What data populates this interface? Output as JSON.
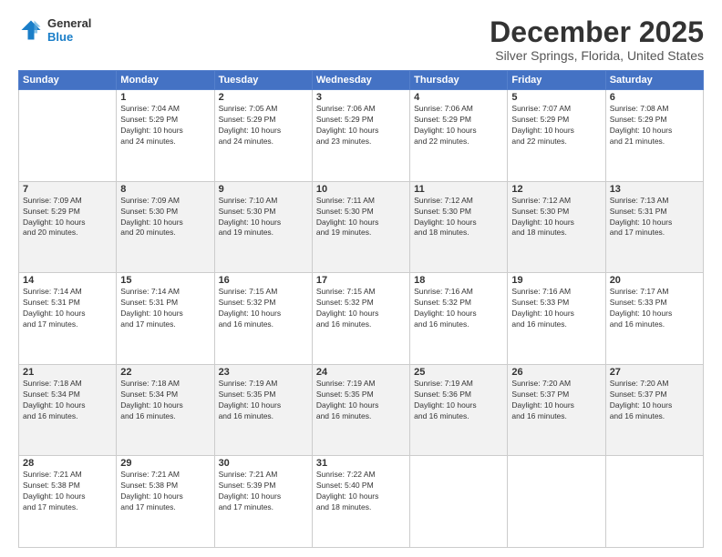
{
  "header": {
    "logo_line1": "General",
    "logo_line2": "Blue",
    "title": "December 2025",
    "subtitle": "Silver Springs, Florida, United States"
  },
  "calendar": {
    "days_of_week": [
      "Sunday",
      "Monday",
      "Tuesday",
      "Wednesday",
      "Thursday",
      "Friday",
      "Saturday"
    ],
    "rows": [
      [
        {
          "day": "",
          "info": ""
        },
        {
          "day": "1",
          "info": "Sunrise: 7:04 AM\nSunset: 5:29 PM\nDaylight: 10 hours\nand 24 minutes."
        },
        {
          "day": "2",
          "info": "Sunrise: 7:05 AM\nSunset: 5:29 PM\nDaylight: 10 hours\nand 24 minutes."
        },
        {
          "day": "3",
          "info": "Sunrise: 7:06 AM\nSunset: 5:29 PM\nDaylight: 10 hours\nand 23 minutes."
        },
        {
          "day": "4",
          "info": "Sunrise: 7:06 AM\nSunset: 5:29 PM\nDaylight: 10 hours\nand 22 minutes."
        },
        {
          "day": "5",
          "info": "Sunrise: 7:07 AM\nSunset: 5:29 PM\nDaylight: 10 hours\nand 22 minutes."
        },
        {
          "day": "6",
          "info": "Sunrise: 7:08 AM\nSunset: 5:29 PM\nDaylight: 10 hours\nand 21 minutes."
        }
      ],
      [
        {
          "day": "7",
          "info": "Sunrise: 7:09 AM\nSunset: 5:29 PM\nDaylight: 10 hours\nand 20 minutes."
        },
        {
          "day": "8",
          "info": "Sunrise: 7:09 AM\nSunset: 5:30 PM\nDaylight: 10 hours\nand 20 minutes."
        },
        {
          "day": "9",
          "info": "Sunrise: 7:10 AM\nSunset: 5:30 PM\nDaylight: 10 hours\nand 19 minutes."
        },
        {
          "day": "10",
          "info": "Sunrise: 7:11 AM\nSunset: 5:30 PM\nDaylight: 10 hours\nand 19 minutes."
        },
        {
          "day": "11",
          "info": "Sunrise: 7:12 AM\nSunset: 5:30 PM\nDaylight: 10 hours\nand 18 minutes."
        },
        {
          "day": "12",
          "info": "Sunrise: 7:12 AM\nSunset: 5:30 PM\nDaylight: 10 hours\nand 18 minutes."
        },
        {
          "day": "13",
          "info": "Sunrise: 7:13 AM\nSunset: 5:31 PM\nDaylight: 10 hours\nand 17 minutes."
        }
      ],
      [
        {
          "day": "14",
          "info": "Sunrise: 7:14 AM\nSunset: 5:31 PM\nDaylight: 10 hours\nand 17 minutes."
        },
        {
          "day": "15",
          "info": "Sunrise: 7:14 AM\nSunset: 5:31 PM\nDaylight: 10 hours\nand 17 minutes."
        },
        {
          "day": "16",
          "info": "Sunrise: 7:15 AM\nSunset: 5:32 PM\nDaylight: 10 hours\nand 16 minutes."
        },
        {
          "day": "17",
          "info": "Sunrise: 7:15 AM\nSunset: 5:32 PM\nDaylight: 10 hours\nand 16 minutes."
        },
        {
          "day": "18",
          "info": "Sunrise: 7:16 AM\nSunset: 5:32 PM\nDaylight: 10 hours\nand 16 minutes."
        },
        {
          "day": "19",
          "info": "Sunrise: 7:16 AM\nSunset: 5:33 PM\nDaylight: 10 hours\nand 16 minutes."
        },
        {
          "day": "20",
          "info": "Sunrise: 7:17 AM\nSunset: 5:33 PM\nDaylight: 10 hours\nand 16 minutes."
        }
      ],
      [
        {
          "day": "21",
          "info": "Sunrise: 7:18 AM\nSunset: 5:34 PM\nDaylight: 10 hours\nand 16 minutes."
        },
        {
          "day": "22",
          "info": "Sunrise: 7:18 AM\nSunset: 5:34 PM\nDaylight: 10 hours\nand 16 minutes."
        },
        {
          "day": "23",
          "info": "Sunrise: 7:19 AM\nSunset: 5:35 PM\nDaylight: 10 hours\nand 16 minutes."
        },
        {
          "day": "24",
          "info": "Sunrise: 7:19 AM\nSunset: 5:35 PM\nDaylight: 10 hours\nand 16 minutes."
        },
        {
          "day": "25",
          "info": "Sunrise: 7:19 AM\nSunset: 5:36 PM\nDaylight: 10 hours\nand 16 minutes."
        },
        {
          "day": "26",
          "info": "Sunrise: 7:20 AM\nSunset: 5:37 PM\nDaylight: 10 hours\nand 16 minutes."
        },
        {
          "day": "27",
          "info": "Sunrise: 7:20 AM\nSunset: 5:37 PM\nDaylight: 10 hours\nand 16 minutes."
        }
      ],
      [
        {
          "day": "28",
          "info": "Sunrise: 7:21 AM\nSunset: 5:38 PM\nDaylight: 10 hours\nand 17 minutes."
        },
        {
          "day": "29",
          "info": "Sunrise: 7:21 AM\nSunset: 5:38 PM\nDaylight: 10 hours\nand 17 minutes."
        },
        {
          "day": "30",
          "info": "Sunrise: 7:21 AM\nSunset: 5:39 PM\nDaylight: 10 hours\nand 17 minutes."
        },
        {
          "day": "31",
          "info": "Sunrise: 7:22 AM\nSunset: 5:40 PM\nDaylight: 10 hours\nand 18 minutes."
        },
        {
          "day": "",
          "info": ""
        },
        {
          "day": "",
          "info": ""
        },
        {
          "day": "",
          "info": ""
        }
      ]
    ]
  }
}
